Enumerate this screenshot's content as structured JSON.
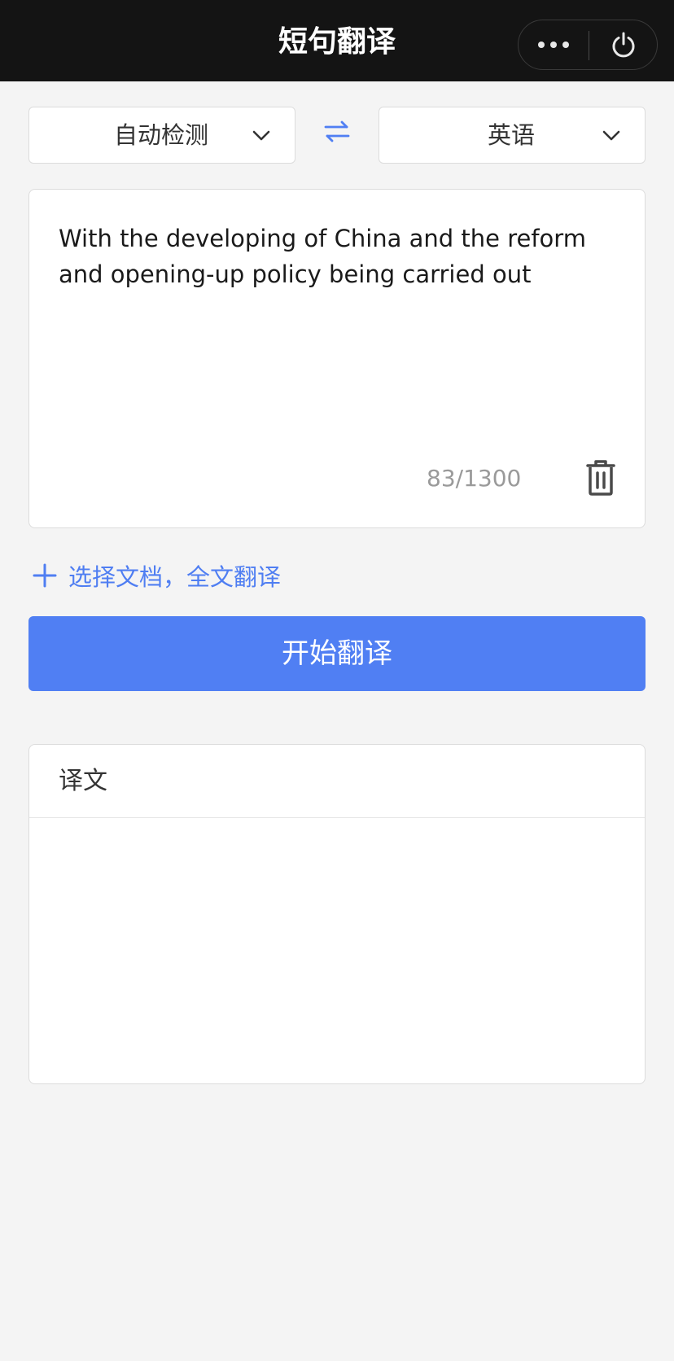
{
  "app": {
    "title": "短句翻译"
  },
  "capsule": {
    "more_icon": "more-dots-icon",
    "power_icon": "power-icon"
  },
  "languages": {
    "source": "自动检测",
    "target": "英语",
    "swap_icon": "swap-arrows-icon",
    "dropdown_icon": "chevron-down-icon"
  },
  "input": {
    "text": "With the developing of China and the reform and opening-up policy being carried out",
    "counter": "83/1300",
    "clear_icon": "trash-icon"
  },
  "document": {
    "label": "选择文档，全文翻译",
    "icon": "plus-icon"
  },
  "actions": {
    "translate_label": "开始翻译"
  },
  "result": {
    "title": "译文",
    "text": ""
  },
  "colors": {
    "accent": "#507ff3",
    "navbar": "#141414",
    "background": "#f4f4f4"
  }
}
